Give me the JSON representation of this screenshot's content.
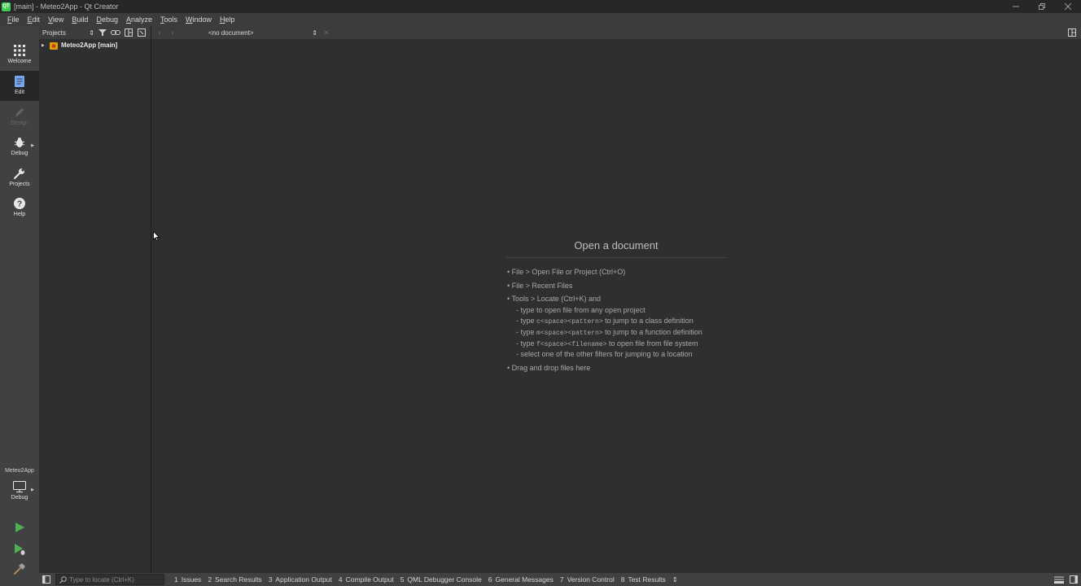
{
  "window": {
    "title": "[main] - Meteo2App - Qt Creator",
    "logo_text": "QT"
  },
  "menu": [
    {
      "underline": "F",
      "rest": "ile"
    },
    {
      "underline": "E",
      "rest": "dit"
    },
    {
      "underline": "V",
      "rest": "iew"
    },
    {
      "underline": "B",
      "rest": "uild"
    },
    {
      "underline": "D",
      "rest": "ebug"
    },
    {
      "underline": "A",
      "rest": "nalyze"
    },
    {
      "underline": "T",
      "rest": "ools"
    },
    {
      "underline": "W",
      "rest": "indow"
    },
    {
      "underline": "H",
      "rest": "elp"
    }
  ],
  "modes": [
    {
      "label": "Welcome",
      "icon": "grid-icon"
    },
    {
      "label": "Edit",
      "icon": "document-icon",
      "active": true
    },
    {
      "label": "Design",
      "icon": "pencil-icon",
      "disabled": true
    },
    {
      "label": "Debug",
      "icon": "bug-icon"
    },
    {
      "label": "Projects",
      "icon": "wrench-icon"
    },
    {
      "label": "Help",
      "icon": "help-icon"
    }
  ],
  "kit": {
    "project": "Meteo2App",
    "build_config": "Debug"
  },
  "projects_pane": {
    "view_label": "Projects",
    "tree": [
      {
        "label": "Meteo2App [main]"
      }
    ]
  },
  "editor": {
    "document_label": "<no document>",
    "open_title": "Open a document",
    "hints": {
      "file_open": "• File > Open File or Project (Ctrl+O)",
      "recent": "• File > Recent Files",
      "locate": "• Tools > Locate (Ctrl+K) and",
      "sub1": "- type to open file from any open project",
      "sub2_a": "- type ",
      "sub2_mono": "c<space><pattern>",
      "sub2_b": " to jump to a class definition",
      "sub3_a": "- type ",
      "sub3_mono": "m<space><pattern>",
      "sub3_b": " to jump to a function definition",
      "sub4_a": "- type ",
      "sub4_mono": "f<space><filename>",
      "sub4_b": " to open file from file system",
      "sub5": "- select one of the other filters for jumping to a location",
      "drag": "• Drag and drop files here"
    }
  },
  "statusbar": {
    "locator_placeholder": "Type to locate (Ctrl+K)",
    "tabs": [
      {
        "num": "1",
        "label": "Issues"
      },
      {
        "num": "2",
        "label": "Search Results"
      },
      {
        "num": "3",
        "label": "Application Output"
      },
      {
        "num": "4",
        "label": "Compile Output"
      },
      {
        "num": "5",
        "label": "QML Debugger Console"
      },
      {
        "num": "6",
        "label": "General Messages"
      },
      {
        "num": "7",
        "label": "Version Control"
      },
      {
        "num": "8",
        "label": "Test Results"
      }
    ]
  },
  "colors": {
    "accent_run": "#4caf50",
    "edit_icon": "#7aa5e8",
    "qt_green": "#41cd52"
  }
}
